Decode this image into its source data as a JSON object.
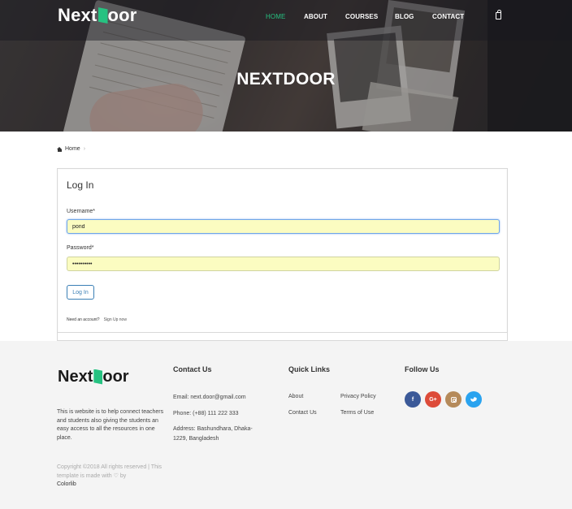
{
  "header": {
    "logo_prefix": "Next",
    "logo_suffix": "oor",
    "nav": [
      {
        "label": "HOME",
        "active": true
      },
      {
        "label": "ABOUT",
        "active": false
      },
      {
        "label": "COURSES",
        "active": false
      },
      {
        "label": "BLOG",
        "active": false
      },
      {
        "label": "CONTACT",
        "active": false
      }
    ],
    "cart_icon": "shopping-bag-icon"
  },
  "hero": {
    "title": "NEXTDOOR"
  },
  "breadcrumb": {
    "home_icon": "home-icon",
    "home_label": "Home",
    "separator": "›"
  },
  "login": {
    "title": "Log In",
    "username_label": "Username*",
    "username_value": "pond",
    "password_label": "Password*",
    "password_value": "••••••••••",
    "button_label": "Log In",
    "account_prompt": "Need an account?",
    "signup_link": "Sign Up now"
  },
  "footer": {
    "logo_prefix": "Next",
    "logo_suffix": "oor",
    "about": "This is website is to help connect teachers and students also giving the students an easy access to all the resources in one place.",
    "copyright": "Copyright ©2018 All rights reserved | This template is made with",
    "copyright_by": "by",
    "credit": "Colorlib",
    "contact": {
      "title": "Contact Us",
      "email": "Email: next.door@gmail.com",
      "phone": "Phone: (+88) 111 222 333",
      "address": "Address: Bashundhara, Dhaka-1229, Bangladesh"
    },
    "quick_links": {
      "title": "Quick Links",
      "items": [
        "About",
        "Privacy Policy",
        "Contact Us",
        "Terms of Use"
      ]
    },
    "follow": {
      "title": "Follow Us",
      "networks": [
        {
          "name": "facebook-icon",
          "glyph": "f",
          "color": "#3b5998"
        },
        {
          "name": "google-plus-icon",
          "glyph": "G+",
          "color": "#dd4b39"
        },
        {
          "name": "instagram-icon",
          "glyph": "",
          "color": "#b58a5a"
        },
        {
          "name": "twitter-icon",
          "glyph": "",
          "color": "#2aa3ef"
        }
      ]
    }
  },
  "colors": {
    "accent": "#26c281",
    "button": "#3a7fb5",
    "autofill": "#fbfcc1"
  }
}
